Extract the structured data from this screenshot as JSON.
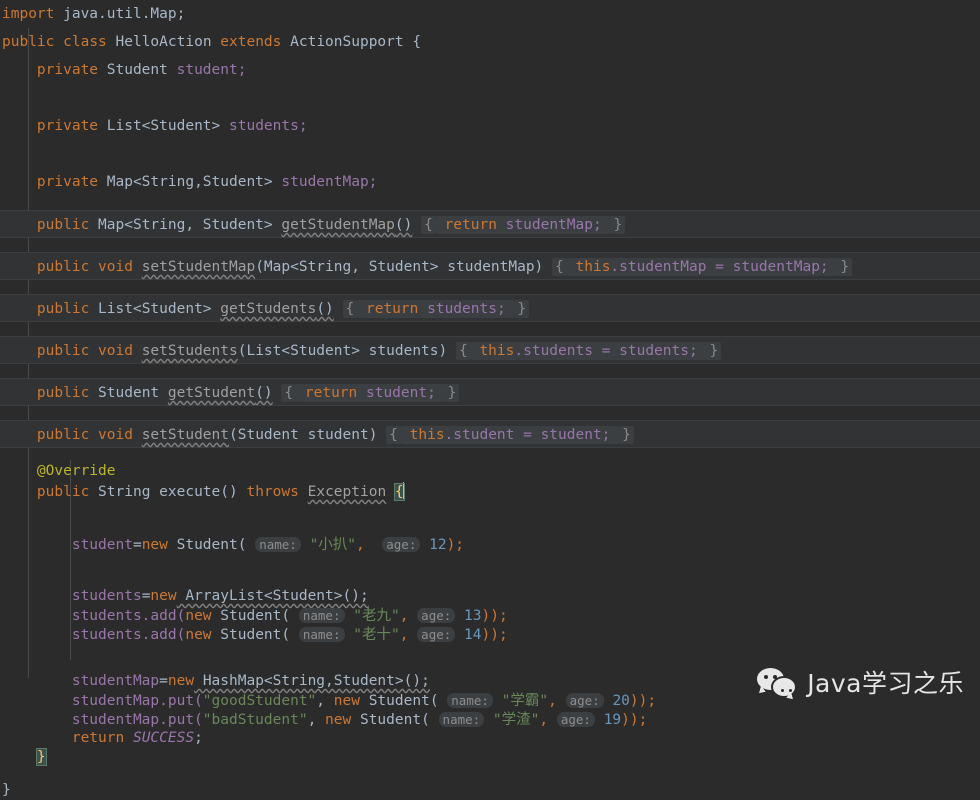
{
  "editor": {
    "language": "Java",
    "theme": "Darcula",
    "background_color": "#2b2b2b",
    "default_text_color": "#a9b7c6",
    "fold_band_color": "#313335",
    "colors": {
      "keyword": "#cc7832",
      "string": "#6a8759",
      "number": "#6897bb",
      "field": "#9876aa",
      "annotation": "#bbb529",
      "inlay_hint": "#8d8d8d",
      "brace_match_highlight": "#3b514d",
      "warning_underline": "#808080"
    }
  },
  "code": {
    "import_line": {
      "keyword": "import",
      "package": " java.util.Map;"
    },
    "class_decl": {
      "modifier": "public",
      "keyword": "class",
      "name": "HelloAction",
      "extends_keyword": "extends",
      "superclass": "ActionSupport",
      "brace": "{"
    },
    "fields": [
      {
        "modifier": "private",
        "type": "Student",
        "name": "student;"
      },
      {
        "modifier": "private",
        "type": "List<Student>",
        "name": "students;"
      },
      {
        "modifier": "private",
        "type": "Map<String,Student>",
        "name": "studentMap;"
      }
    ],
    "methods": [
      {
        "modifier": "public",
        "return_type": "Map<String, Student>",
        "name": "getStudentMap",
        "params": "()",
        "body_open": "{",
        "body": {
          "keyword": "return",
          "expr": " studentMap;"
        },
        "body_close": "}"
      },
      {
        "modifier": "public",
        "return_type": "void",
        "name": "setStudentMap",
        "params": "(Map<String, Student> studentMap)",
        "body_open": "{",
        "body": {
          "keyword": "this",
          "expr": ".studentMap = studentMap;"
        },
        "body_close": "}"
      },
      {
        "modifier": "public",
        "return_type": "List<Student>",
        "name": "getStudents",
        "params": "()",
        "body_open": "{",
        "body": {
          "keyword": "return",
          "expr": " students;"
        },
        "body_close": "}"
      },
      {
        "modifier": "public",
        "return_type": "void",
        "name": "setStudents",
        "params": "(List<Student> students)",
        "body_open": "{",
        "body": {
          "keyword": "this",
          "expr": ".students = students;"
        },
        "body_close": "}"
      },
      {
        "modifier": "public",
        "return_type": "Student",
        "name": "getStudent",
        "params": "()",
        "body_open": "{",
        "body": {
          "keyword": "return",
          "expr": " student;"
        },
        "body_close": "}"
      },
      {
        "modifier": "public",
        "return_type": "void",
        "name": "setStudent",
        "params": "(Student student)",
        "body_open": "{",
        "body": {
          "keyword": "this",
          "expr": ".student = student;"
        },
        "body_close": "}"
      }
    ],
    "execute_method": {
      "annotation": "@Override",
      "modifier": "public",
      "return_type": "String",
      "name": "execute",
      "params": "()",
      "throws_keyword": "throws",
      "exception": "Exception",
      "open_brace": "{",
      "statements": {
        "student_assign": {
          "target": "student",
          "equals": "=",
          "new_keyword": "new",
          "type": " Student",
          "open_paren": "(",
          "hint_name": "name:",
          "name_value": "\"小扒\"",
          "comma": ",",
          "hint_age": "age:",
          "age_value": "12",
          "tail": ");"
        },
        "students_new": {
          "target": "students",
          "equals": "=",
          "new_keyword": "new",
          "type": " ArrayList<Student>();"
        },
        "students_add": [
          {
            "prefix": "students.add(",
            "new_keyword": "new",
            "type": " Student",
            "open_paren": "(",
            "hint_name": "name:",
            "name_value": "\"老九\"",
            "comma": ",",
            "hint_age": "age:",
            "age_value": "13",
            "tail": "));"
          },
          {
            "prefix": "students.add(",
            "new_keyword": "new",
            "type": " Student",
            "open_paren": "(",
            "hint_name": "name:",
            "name_value": "\"老十\"",
            "comma": ",",
            "hint_age": "age:",
            "age_value": "14",
            "tail": "));"
          }
        ],
        "map_new": {
          "target": "studentMap",
          "equals": "=",
          "new_keyword": "new",
          "type": " HashMap<String,Student>();"
        },
        "map_put": [
          {
            "prefix": "studentMap.put(",
            "key": "\"goodStudent\"",
            "sep": ", ",
            "new_keyword": "new",
            "type": " Student",
            "open_paren": "(",
            "hint_name": "name:",
            "name_value": "\"学霸\"",
            "comma": ",",
            "hint_age": "age:",
            "age_value": "20",
            "tail": "));"
          },
          {
            "prefix": "studentMap.put(",
            "key": "\"badStudent\"",
            "sep": ", ",
            "new_keyword": "new",
            "type": " Student",
            "open_paren": "(",
            "hint_name": "name:",
            "name_value": "\"学渣\"",
            "comma": ",",
            "hint_age": "age:",
            "age_value": "19",
            "tail": "));"
          }
        ],
        "return_stmt": {
          "keyword": "return",
          "value": "SUCCESS",
          "semi": ";"
        }
      },
      "close_brace": "}"
    },
    "class_close_brace": "}"
  },
  "watermark": {
    "icon": "wechat-icon",
    "text": "Java学习之乐"
  }
}
